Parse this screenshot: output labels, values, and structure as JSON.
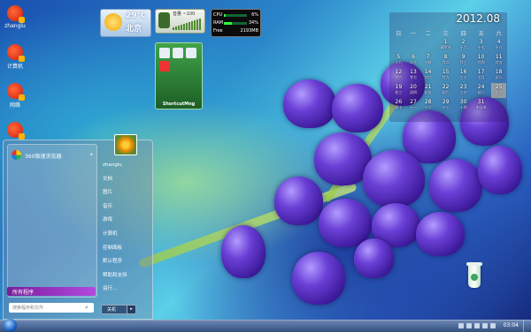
{
  "desktop_icons": [
    {
      "label": "zhanglu",
      "icon": "user-folder-icon"
    },
    {
      "label": "计算机",
      "icon": "computer-icon"
    },
    {
      "label": "网络",
      "icon": "network-icon"
    },
    {
      "label": "",
      "icon": "shortcut-icon"
    }
  ],
  "weather": {
    "temp": "29℃",
    "city": "北京"
  },
  "volume": {
    "label": "音量 ~100"
  },
  "cpu_meter": {
    "rows": [
      {
        "key": "CPU",
        "value": "6%",
        "fill": 0.06
      },
      {
        "key": "RAM",
        "value": "34%",
        "fill": 0.34
      },
      {
        "key": "Free",
        "value": "2193MB",
        "fill": 0
      }
    ]
  },
  "shortcut_gadget": {
    "name": "ShortcutMng"
  },
  "calendar": {
    "title": "2012.08",
    "weekdays": [
      "日",
      "一",
      "二",
      "三",
      "四",
      "五",
      "六"
    ],
    "weeks": [
      [
        {
          "d": "",
          "l": ""
        },
        {
          "d": "",
          "l": ""
        },
        {
          "d": "",
          "l": ""
        },
        {
          "d": "1",
          "l": "建军节"
        },
        {
          "d": "2",
          "l": "十六"
        },
        {
          "d": "3",
          "l": "十七"
        },
        {
          "d": "4",
          "l": "十八"
        }
      ],
      [
        {
          "d": "5",
          "l": "十九"
        },
        {
          "d": "6",
          "l": "二十"
        },
        {
          "d": "7",
          "l": "立秋"
        },
        {
          "d": "8",
          "l": "廿二"
        },
        {
          "d": "9",
          "l": "廿三"
        },
        {
          "d": "10",
          "l": "廿四"
        },
        {
          "d": "11",
          "l": "廿五"
        }
      ],
      [
        {
          "d": "12",
          "l": "廿六"
        },
        {
          "d": "13",
          "l": "廿七"
        },
        {
          "d": "14",
          "l": "廿八"
        },
        {
          "d": "15",
          "l": "廿九"
        },
        {
          "d": "16",
          "l": "三十"
        },
        {
          "d": "17",
          "l": "七月"
        },
        {
          "d": "18",
          "l": "初二"
        }
      ],
      [
        {
          "d": "19",
          "l": "初三"
        },
        {
          "d": "20",
          "l": "初四"
        },
        {
          "d": "21",
          "l": "初五"
        },
        {
          "d": "22",
          "l": "初六"
        },
        {
          "d": "23",
          "l": "七夕"
        },
        {
          "d": "24",
          "l": "初八"
        },
        {
          "d": "25",
          "l": "初九"
        }
      ],
      [
        {
          "d": "26",
          "l": "初十"
        },
        {
          "d": "27",
          "l": "十一"
        },
        {
          "d": "28",
          "l": "十二"
        },
        {
          "d": "29",
          "l": "十三"
        },
        {
          "d": "30",
          "l": "十四"
        },
        {
          "d": "31",
          "l": "中元节"
        },
        {
          "d": "",
          "l": ""
        }
      ]
    ],
    "today": "25"
  },
  "start_menu": {
    "pinned": "360极速浏览器",
    "all_programs": "所有程序",
    "search_placeholder": "搜索程序和文件",
    "user": "zhanglu",
    "right_items": [
      "zhanglu",
      "文档",
      "图片",
      "音乐",
      "游戏",
      "计算机",
      "控制面板",
      "默认程序",
      "帮助和支持",
      "运行..."
    ],
    "shutdown": "关机"
  },
  "taskbar": {
    "clock": "03:04"
  }
}
